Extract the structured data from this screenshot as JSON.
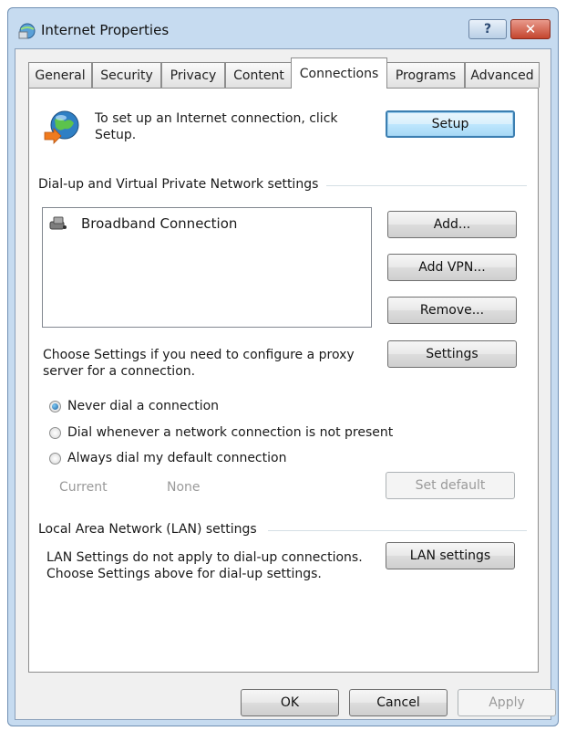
{
  "window": {
    "title": "Internet Properties",
    "help_label": "?",
    "close_label": "✕"
  },
  "tabs": [
    {
      "label": "General",
      "active": false
    },
    {
      "label": "Security",
      "active": false
    },
    {
      "label": "Privacy",
      "active": false
    },
    {
      "label": "Content",
      "active": false
    },
    {
      "label": "Connections",
      "active": true
    },
    {
      "label": "Programs",
      "active": false
    },
    {
      "label": "Advanced",
      "active": false
    }
  ],
  "setup": {
    "text": "To set up an Internet connection, click Setup.",
    "button": "Setup",
    "icon": "globe-network-icon"
  },
  "dialup": {
    "group_label": "Dial-up and Virtual Private Network settings",
    "connections": [
      {
        "name": "Broadband Connection",
        "icon": "broadband-connection-icon"
      }
    ],
    "add_button": "Add...",
    "add_vpn_button": "Add VPN...",
    "remove_button": "Remove...",
    "proxy_text": "Choose Settings if you need to configure a proxy server for a connection.",
    "settings_button": "Settings",
    "radios": [
      {
        "label": "Never dial a connection",
        "checked": true
      },
      {
        "label": "Dial whenever a network connection is not present",
        "checked": false
      },
      {
        "label": "Always dial my default connection",
        "checked": false
      }
    ],
    "current_label": "Current",
    "current_value": "None",
    "set_default_button": "Set default"
  },
  "lan": {
    "group_label": "Local Area Network (LAN) settings",
    "text": "LAN Settings do not apply to dial-up connections. Choose Settings above for dial-up settings.",
    "button": "LAN settings"
  },
  "footer": {
    "ok": "OK",
    "cancel": "Cancel",
    "apply": "Apply"
  }
}
